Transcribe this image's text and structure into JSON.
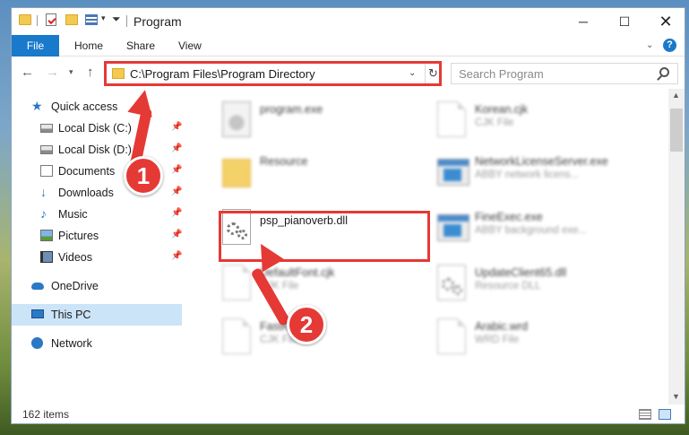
{
  "window": {
    "title": "Program"
  },
  "ribbon": {
    "tabs": [
      "File",
      "Home",
      "Share",
      "View"
    ]
  },
  "address": {
    "path": "C:\\Program Files\\Program Directory"
  },
  "search": {
    "placeholder": "Search Program"
  },
  "sidebar": {
    "quick_access": "Quick access",
    "items": [
      {
        "label": "Local Disk (C:)",
        "pinned": true
      },
      {
        "label": "Local Disk (D:)",
        "pinned": true
      },
      {
        "label": "Documents",
        "pinned": true
      },
      {
        "label": "Downloads",
        "pinned": true
      },
      {
        "label": "Music",
        "pinned": true
      },
      {
        "label": "Pictures",
        "pinned": true
      },
      {
        "label": "Videos",
        "pinned": true
      }
    ],
    "onedrive": "OneDrive",
    "this_pc": "This PC",
    "network": "Network"
  },
  "files": [
    {
      "name": "program.exe",
      "type": "",
      "icon": "setup-icon"
    },
    {
      "name": "Korean.cjk",
      "type": "CJK File",
      "icon": "page-icon"
    },
    {
      "name": "Resource",
      "type": "",
      "icon": "folder-icon"
    },
    {
      "name": "NetworkLicenseServer.exe",
      "type": "ABBY network licens...",
      "icon": "exe-icon"
    },
    {
      "name": "psp_pianoverb.dll",
      "type": "",
      "icon": "gears-icon"
    },
    {
      "name": "FineExec.exe",
      "type": "ABBY background exe...",
      "icon": "exe-icon"
    },
    {
      "name": "DefaultFont.cjk",
      "type": "CJK File",
      "icon": "page-icon"
    },
    {
      "name": "UpdateClient65.dll",
      "type": "Resource DLL",
      "icon": "gears-icon"
    },
    {
      "name": "FastKor",
      "type": "CJK File",
      "icon": "page-icon"
    },
    {
      "name": "Arabic.wrd",
      "type": "WRD File",
      "icon": "page-icon"
    }
  ],
  "status": {
    "item_count": "162 items"
  },
  "annotations": {
    "step1": "1",
    "step2": "2"
  },
  "colors": {
    "accent": "#1979ca",
    "highlight": "#e53935",
    "selection": "#cce4f7"
  }
}
